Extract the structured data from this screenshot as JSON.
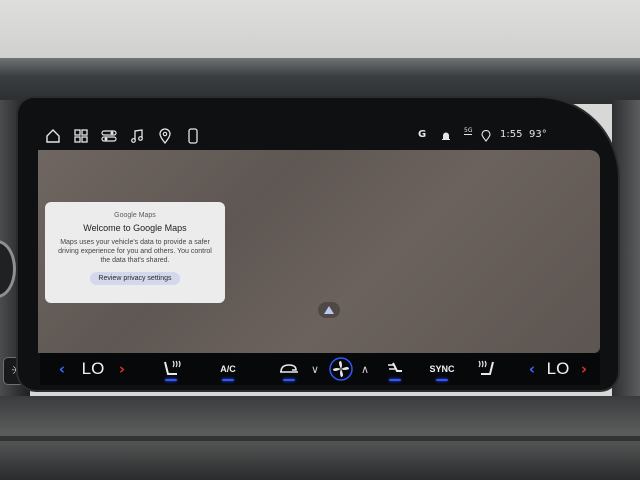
{
  "status_bar": {
    "nav_icons": [
      "home-icon",
      "apps-grid-icon",
      "controls-icon",
      "music-note-icon",
      "location-pin-icon",
      "phone-icon"
    ],
    "g_label": "G",
    "network_label": "5G",
    "time": "1:55",
    "temperature": "93°"
  },
  "welcome_card": {
    "brand": "Google Maps",
    "title": "Welcome to Google Maps",
    "body": "Maps uses your vehicle's data to provide a safer driving experience for you and others. You control the data that's shared.",
    "button_label": "Review privacy settings"
  },
  "climate": {
    "left_temp": "LO",
    "right_temp": "LO",
    "ac_label": "A/C",
    "sync_label": "SYNC",
    "accent": "#2f56ff",
    "arrow_color": "#e0342c",
    "left_arrow_color": "#3b6cff"
  }
}
